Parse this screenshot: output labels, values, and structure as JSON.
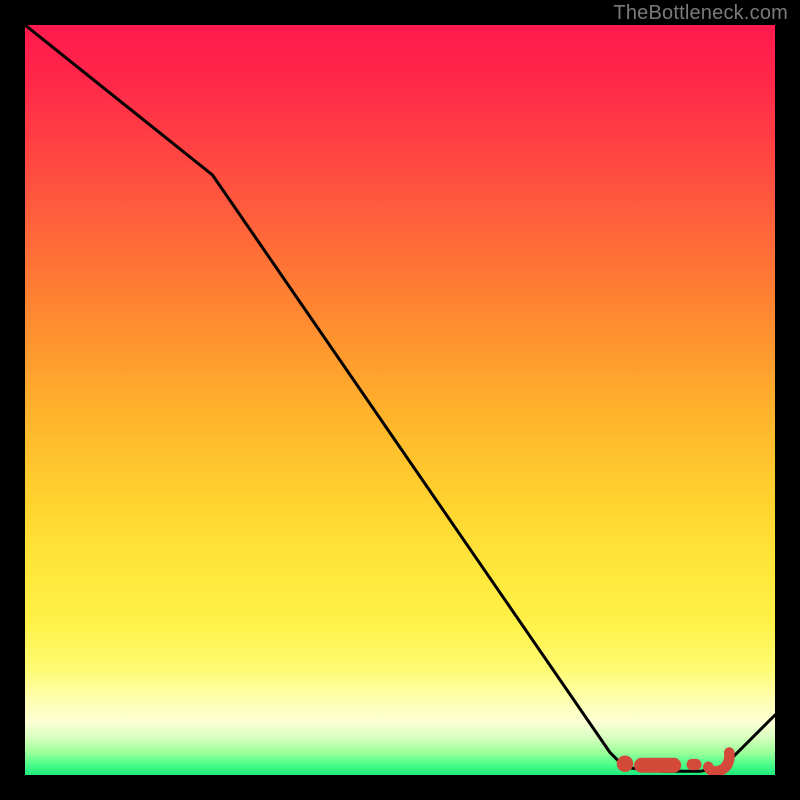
{
  "watermark_text": "TheBottleneck.com",
  "chart_data": {
    "type": "line",
    "title": "",
    "xlabel": "",
    "ylabel": "",
    "xlim": [
      0,
      100
    ],
    "ylim": [
      0,
      100
    ],
    "grid": false,
    "background_gradient": {
      "top_color": "#ff1a4d",
      "mid_color": "#ffe63a",
      "bottom_color": "#1de97c"
    },
    "series": [
      {
        "name": "bottleneck-curve",
        "color": "#000000",
        "style": "solid",
        "x": [
          0,
          25,
          78,
          80,
          85,
          90,
          93,
          100
        ],
        "y": [
          100,
          80,
          3,
          1,
          0.5,
          0.5,
          1,
          8
        ]
      }
    ],
    "markers": [
      {
        "name": "optimal-dot-1",
        "shape": "circle",
        "color": "#d44a3a",
        "x": 80,
        "y": 1.5,
        "r": 1.1
      },
      {
        "name": "optimal-lozenge",
        "shape": "lozenge",
        "color": "#d44a3a",
        "x_start": 81.2,
        "x_end": 87.5,
        "y": 1.3,
        "h": 2.0
      },
      {
        "name": "optimal-dash",
        "shape": "dash",
        "color": "#d44a3a",
        "x_start": 88.2,
        "x_end": 90.2,
        "y": 1.4,
        "h": 1.5
      },
      {
        "name": "optimal-curl",
        "shape": "curl",
        "color": "#d44a3a",
        "x": 92.5,
        "y": 1.8
      }
    ]
  }
}
